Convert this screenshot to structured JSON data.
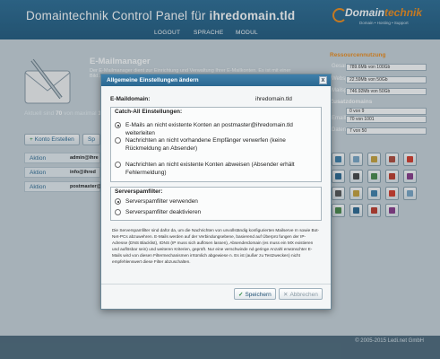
{
  "header": {
    "title_prefix": "Domaintechnik Control Panel für ",
    "title_domain": "ihredomain.tld",
    "logo_main": "Domain",
    "logo_accent": "technik",
    "logo_tagline": "Domain • Hosting • Support",
    "nav": [
      "LOGOUT",
      "SPRACHE",
      "MODUL"
    ]
  },
  "background": {
    "heading": "E-Mailmanager",
    "intro": "Der E-Mailmanager dient zur Einrichtung und Verwaltung Ihrer E-Mailkonten. Es ist mit einer Bild...",
    "count_prefix": "Aktuell sind",
    "count_value": "70",
    "count_suffix": "von maximal",
    "count_max": "1",
    "buttons": [
      "Konto Erstellen",
      "Sp"
    ],
    "rows": [
      {
        "action": "Aktion",
        "address": "admin@ihre"
      },
      {
        "action": "Aktion",
        "address": "info@ihred"
      },
      {
        "action": "Aktion",
        "address": "postmaster@"
      }
    ],
    "sidebar_title": "Ressourcennutzung",
    "resources": [
      {
        "label": "Gesamt",
        "value": "789.6Mb von 100Gb"
      },
      {
        "label": "Webspace",
        "value": "22.59Mb von 50Gb"
      },
      {
        "label": "Mailspace",
        "value": "746.92Mb von 50Gb"
      }
    ],
    "section_title": "Zusatzdomains",
    "extras": [
      {
        "label": "",
        "value": "0 von 9"
      },
      {
        "label": "Emailkonten",
        "value": "70 von 1001"
      },
      {
        "label": "Datenbanken",
        "value": "7 von 50"
      }
    ]
  },
  "footer": {
    "copyright": "© 2005-2015 Ledi.net GmbH"
  },
  "dialog": {
    "title": "Allgemeine Einstellungen ändern",
    "close_label": "x",
    "email_label": "E-Maildomain:",
    "email_value": "ihredomain.tld",
    "catchall_legend": "Catch-All Einstellungen:",
    "catchall_options": [
      {
        "label": "E-Mails an nicht existente Konten an postmaster@ihredomain.tld weiterleiten",
        "checked": true
      },
      {
        "label": "Nachrichten an nicht vorhandene Empfänger verwerfen (keine Rückmeldung an Absender)",
        "checked": false
      },
      {
        "label": "Nachrichten an nicht existente Konten abweisen (Absender erhält Fehlermeldung)",
        "checked": false
      }
    ],
    "spam_legend": "Serverspamfilter:",
    "spam_options": [
      {
        "label": "Serverspamfilter verwenden",
        "checked": true
      },
      {
        "label": "Serverspamfilter deaktivieren",
        "checked": false
      }
    ],
    "info": "Die Serverspamfilter sind dafür da, um die Nachrichten von unvollständig konfigurierten Mailserve rn sowie Bot-Net-PCs abzuwehren. E-Mails werden auf der Verbindungsebene, basierend auf Überprü fungen der IP-Adresse (DNS Blacklist), rDNS (IP muss sich auflösen lassen), Absenderdomain (es muss ein MX existieren und auflösbar sein) und weiteren Kriterien, geprüft. Nur eine verschwinde nd geringe Anzahl erwünschter E-Mails wird von diesen Filtermechanismen irrtümlich abgewiese n. Es ist (außer zu Testzwecken) nicht empfehlenswert diese Filter abzuschalten.",
    "save_label": "Speichern",
    "cancel_label": "Abbrechen"
  }
}
